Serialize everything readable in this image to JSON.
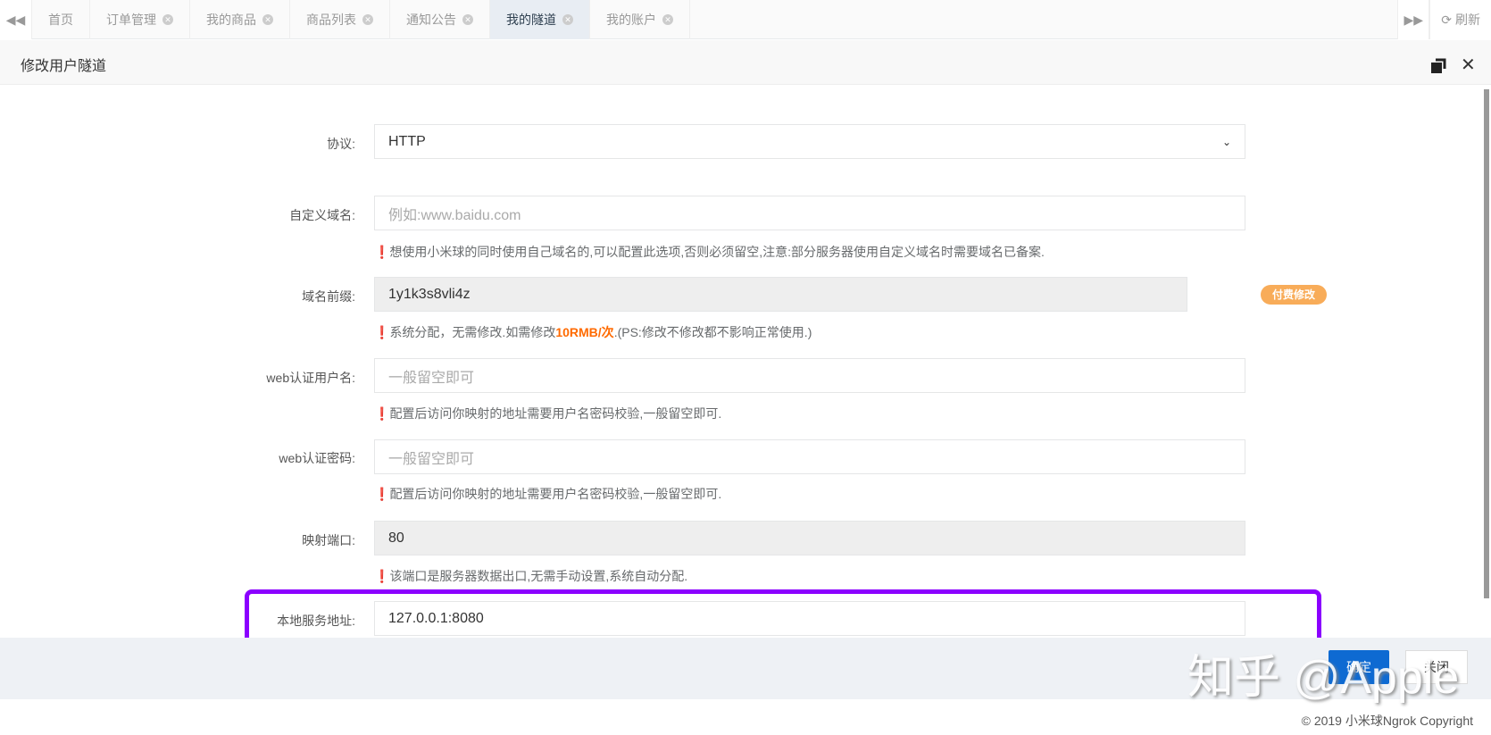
{
  "tabs": [
    {
      "label": "首页",
      "closable": false
    },
    {
      "label": "订单管理",
      "closable": true
    },
    {
      "label": "我的商品",
      "closable": true
    },
    {
      "label": "商品列表",
      "closable": true
    },
    {
      "label": "通知公告",
      "closable": true
    },
    {
      "label": "我的隧道",
      "closable": true,
      "active": true
    },
    {
      "label": "我的账户",
      "closable": true
    }
  ],
  "refresh_label": "刷新",
  "dialog": {
    "title": "修改用户隧道"
  },
  "form": {
    "protocol": {
      "label": "协议:",
      "value": "HTTP"
    },
    "custom_domain": {
      "label": "自定义域名:",
      "placeholder": "例如:www.baidu.com",
      "hint": "想使用小米球的同时使用自己域名的,可以配置此选项,否则必须留空,注意:部分服务器使用自定义域名时需要域名已备案."
    },
    "prefix": {
      "label": "域名前缀:",
      "value": "1y1k3s8vli4z",
      "badge": "付费修改",
      "hint_pre": "系统分配，无需修改.如需修改",
      "hint_price": "10RMB/次",
      "hint_post": ".(PS:修改不修改都不影响正常使用.)"
    },
    "web_user": {
      "label": "web认证用户名:",
      "placeholder": "一般留空即可",
      "hint": "配置后访问你映射的地址需要用户名密码校验,一般留空即可."
    },
    "web_pass": {
      "label": "web认证密码:",
      "placeholder": "一般留空即可",
      "hint": "配置后访问你映射的地址需要用户名密码校验,一般留空即可."
    },
    "port": {
      "label": "映射端口:",
      "value": "80",
      "hint": "该端口是服务器数据出口,无需手动设置,系统自动分配."
    },
    "local": {
      "label": "本地服务地址:",
      "value": "127.0.0.1:8080"
    }
  },
  "buttons": {
    "ok": "确定",
    "close": "关闭"
  },
  "watermark": "知乎 @Apple",
  "copyright": "© 2019 小米球Ngrok Copyright",
  "colors": {
    "highlight": "#8b00ff",
    "primary": "#0e6ad2",
    "badge": "#f8ac59",
    "price": "#ff6a00"
  }
}
